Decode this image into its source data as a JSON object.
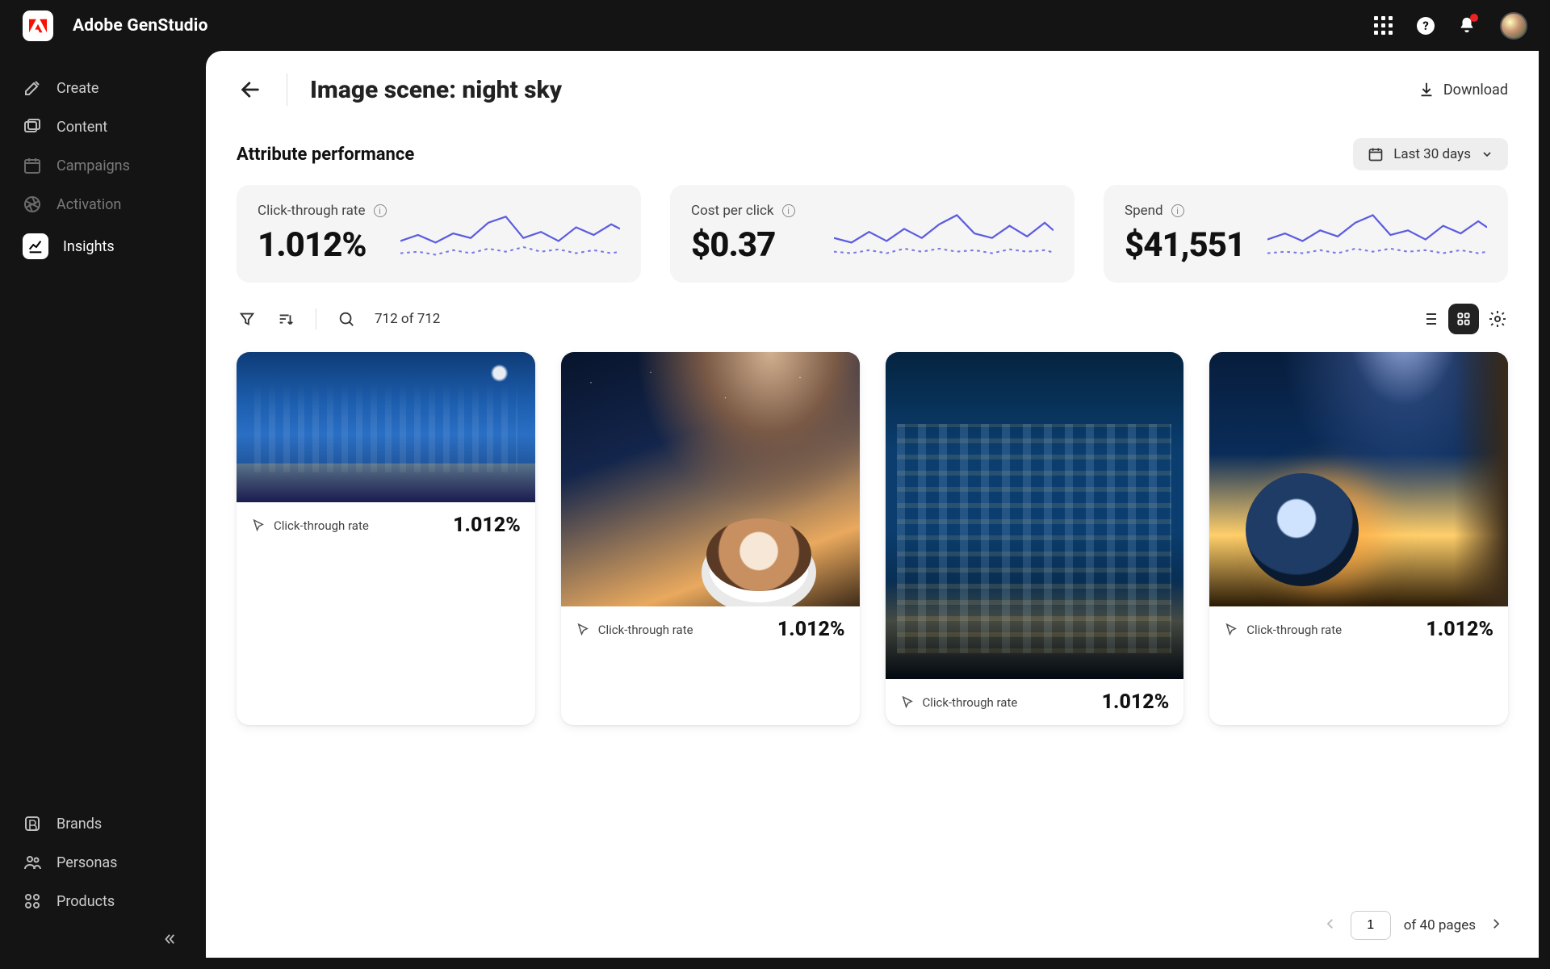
{
  "brand": "Adobe GenStudio",
  "sidebar": {
    "items": [
      {
        "label": "Create",
        "icon": "brush-icon",
        "state": "normal"
      },
      {
        "label": "Content",
        "icon": "images-icon",
        "state": "normal"
      },
      {
        "label": "Campaigns",
        "icon": "calendar-icon",
        "state": "dim"
      },
      {
        "label": "Activation",
        "icon": "aperture-icon",
        "state": "dim"
      },
      {
        "label": "Insights",
        "icon": "chart-icon",
        "state": "active"
      }
    ],
    "bottom": [
      {
        "label": "Brands",
        "icon": "brand-icon"
      },
      {
        "label": "Personas",
        "icon": "personas-icon"
      },
      {
        "label": "Products",
        "icon": "products-icon"
      }
    ]
  },
  "header": {
    "title": "Image scene: night sky",
    "download": "Download"
  },
  "section_title": "Attribute performance",
  "period": {
    "label": "Last 30 days"
  },
  "metrics": [
    {
      "label": "Click-through rate",
      "value": "1.012%"
    },
    {
      "label": "Cost per click",
      "value": "$0.37"
    },
    {
      "label": "Spend",
      "value": "$41,551"
    }
  ],
  "results": {
    "count": "712 of 712"
  },
  "tiles": [
    {
      "metric_label": "Click-through rate",
      "metric_value": "1.012%"
    },
    {
      "metric_label": "Click-through rate",
      "metric_value": "1.012%"
    },
    {
      "metric_label": "Click-through rate",
      "metric_value": "1.012%"
    },
    {
      "metric_label": "Click-through rate",
      "metric_value": "1.012%"
    }
  ],
  "pagination": {
    "current": "1",
    "total_text": "of 40 pages"
  }
}
